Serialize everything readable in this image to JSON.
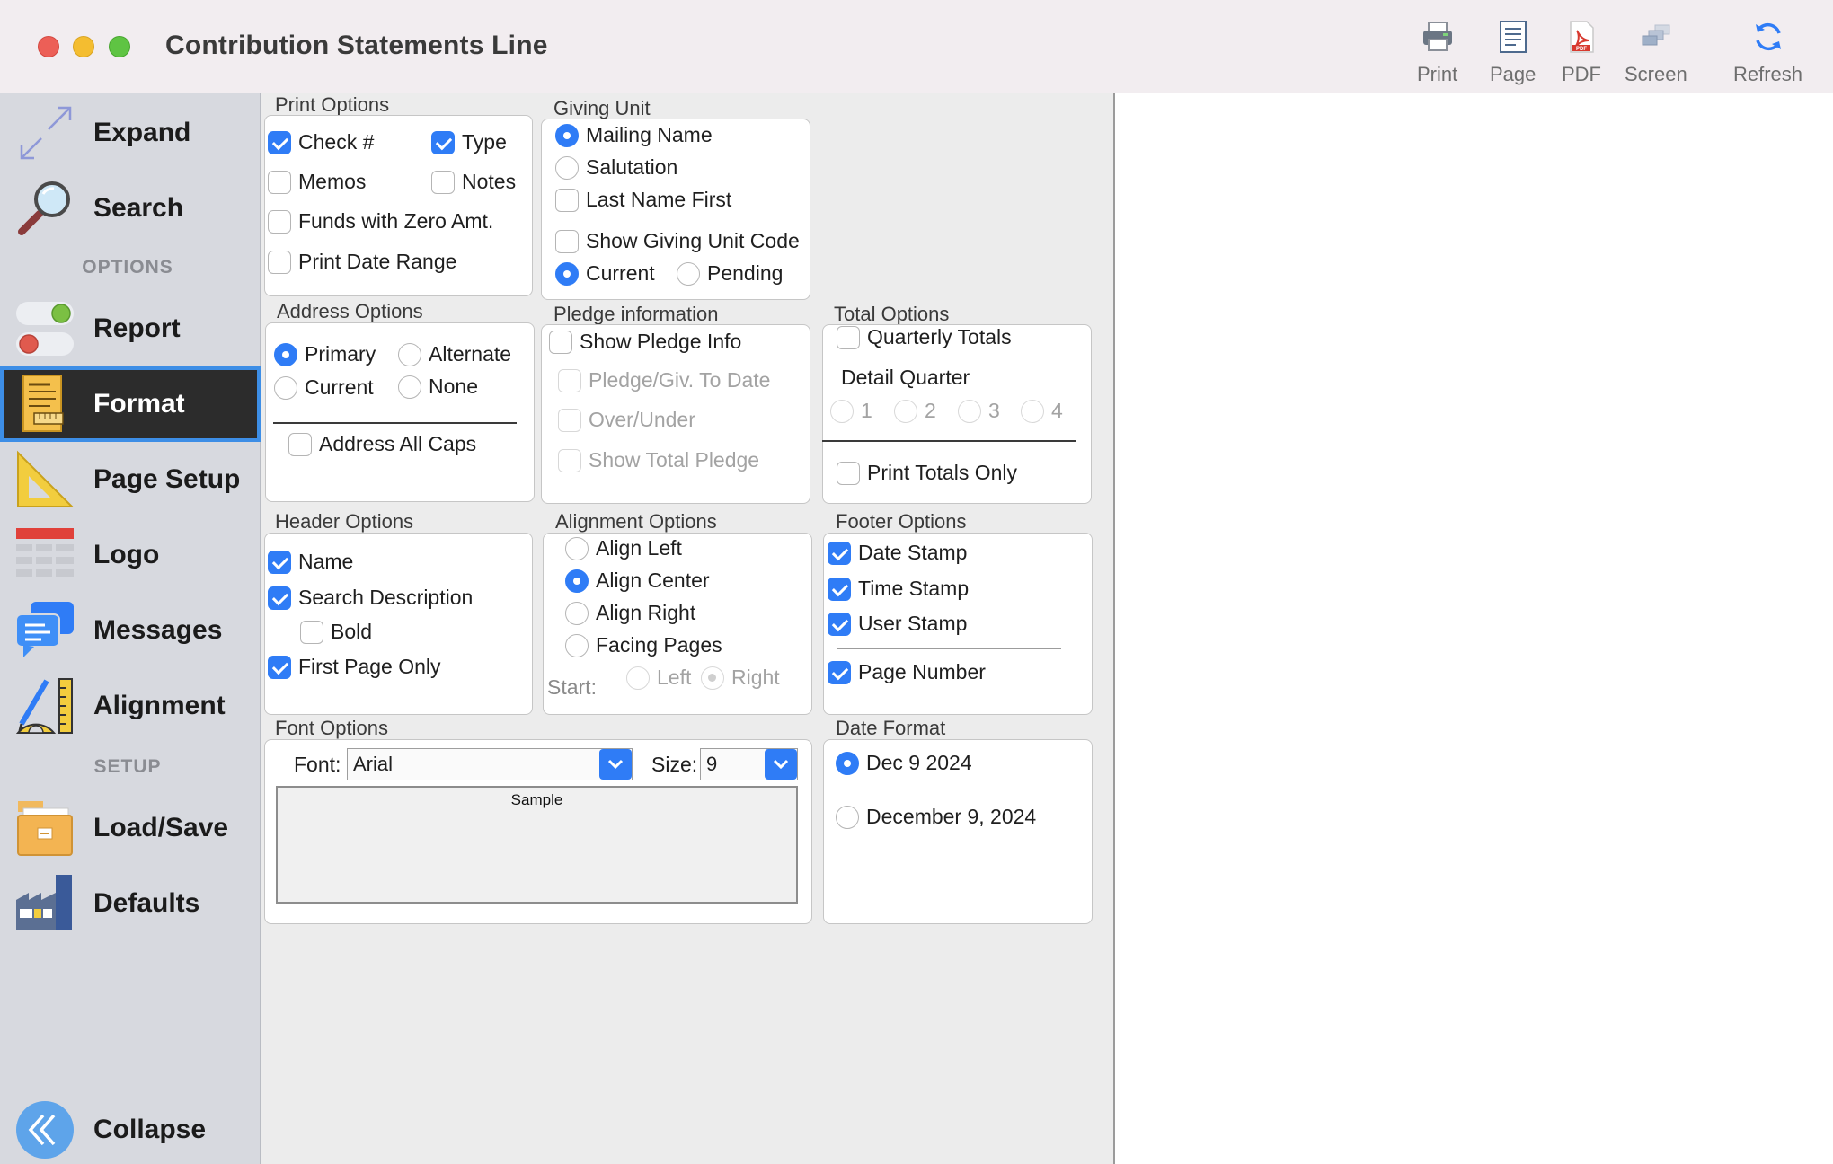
{
  "window": {
    "title": "Contribution Statements Line"
  },
  "toolbar": {
    "print": "Print",
    "page": "Page",
    "pdf": "PDF",
    "screen": "Screen",
    "refresh": "Refresh",
    "pdf_badge": "PDF"
  },
  "sidebar": {
    "expand": "Expand",
    "search": "Search",
    "options_header": "OPTIONS",
    "report": "Report",
    "format": "Format",
    "page_setup": "Page Setup",
    "logo": "Logo",
    "messages": "Messages",
    "alignment": "Alignment",
    "setup_header": "SETUP",
    "load_save": "Load/Save",
    "defaults": "Defaults",
    "collapse": "Collapse"
  },
  "print_options": {
    "title": "Print Options",
    "check_no": "Check #",
    "type": "Type",
    "memos": "Memos",
    "notes": "Notes",
    "funds_zero": "Funds with Zero Amt.",
    "print_date_range": "Print Date Range"
  },
  "giving_unit": {
    "title": "Giving Unit",
    "mailing_name": "Mailing Name",
    "salutation": "Salutation",
    "last_name_first": "Last Name First",
    "show_code": "Show Giving Unit Code",
    "current": "Current",
    "pending": "Pending"
  },
  "address_options": {
    "title": "Address Options",
    "primary": "Primary",
    "alternate": "Alternate",
    "current": "Current",
    "none": "None",
    "all_caps": "Address All Caps"
  },
  "pledge_info": {
    "title": "Pledge information",
    "show": "Show Pledge Info",
    "to_date": "Pledge/Giv. To Date",
    "over_under": "Over/Under",
    "total": "Show Total Pledge"
  },
  "total_options": {
    "title": "Total Options",
    "quarterly": "Quarterly Totals",
    "detail_quarter": "Detail Quarter",
    "q1": "1",
    "q2": "2",
    "q3": "3",
    "q4": "4",
    "totals_only": "Print Totals Only"
  },
  "header_options": {
    "title": "Header Options",
    "name": "Name",
    "search_desc": "Search Description",
    "bold": "Bold",
    "first_page": "First Page Only"
  },
  "alignment_options": {
    "title": "Alignment Options",
    "left": "Align Left",
    "center": "Align Center",
    "right": "Align Right",
    "facing": "Facing Pages",
    "start": "Start:",
    "start_left": "Left",
    "start_right": "Right"
  },
  "footer_options": {
    "title": "Footer Options",
    "date": "Date Stamp",
    "time": "Time Stamp",
    "user": "User Stamp",
    "page_number": "Page Number"
  },
  "font_options": {
    "title": "Font Options",
    "font_label": "Font:",
    "font_value": "Arial",
    "size_label": "Size:",
    "size_value": "9",
    "sample": "Sample"
  },
  "date_format": {
    "title": "Date Format",
    "short": "Dec 9 2024",
    "long": "December 9, 2024"
  },
  "colors": {
    "accent": "#2f7cf6",
    "active_bg": "#2c2c2c",
    "active_outline": "#3d8ee6",
    "sidebar_bg": "#d7d9df"
  }
}
